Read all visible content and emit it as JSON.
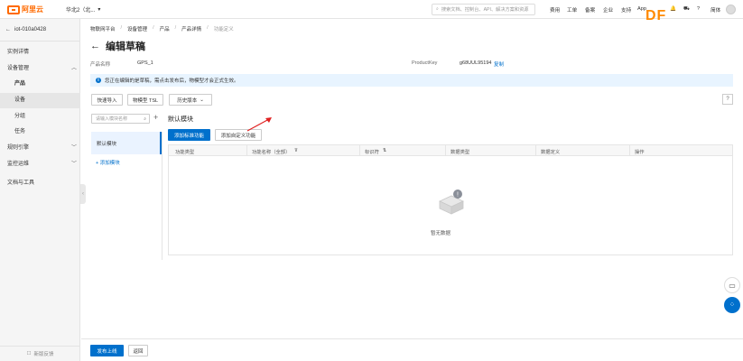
{
  "topbar": {
    "brand": "阿里云",
    "workspace": "华北2（北...",
    "search_placeholder": "搜索文档、控制台、API、解决方案和资源",
    "nav": [
      "费用",
      "工单",
      "备案",
      "企业",
      "支持",
      "App"
    ],
    "lang": "简体",
    "watermark": "DF"
  },
  "sidebar": {
    "instance": "iot-010a0428",
    "items": {
      "instance_detail": "实例详情",
      "device_management": "设备管理",
      "product": "产品",
      "device": "设备",
      "group": "分组",
      "task": "任务",
      "rule_engine": "规则引擎",
      "monitor": "监控运维",
      "docs_tools": "文档与工具"
    },
    "bottom": "新版反馈"
  },
  "breadcrumb": [
    "物联网平台",
    "设备管理",
    "产品",
    "产品详情",
    "功能定义"
  ],
  "page": {
    "title": "编辑草稿",
    "product_name_label": "产品名称",
    "product_name_value": "GPS_1",
    "product_key_label": "ProductKey",
    "product_key_value": "g68UUL95194",
    "copy_label": "复制"
  },
  "notice": "您正在编辑的是草稿，需点击发布后，物模型才会正式生效。",
  "toolbar": {
    "quick_import": "快速导入",
    "tsl": "物模型 TSL",
    "history": "历史版本"
  },
  "modules": {
    "search_placeholder": "请输入模块名称",
    "default": "默认模块",
    "add": "+ 添加模块",
    "current_title": "默认模块"
  },
  "actions": {
    "add_standard": "添加标准功能",
    "add_custom": "添加自定义功能"
  },
  "table": {
    "headers": [
      "功能类型",
      "功能名称（全部）",
      "标识符",
      "数据类型",
      "数据定义",
      "操作"
    ],
    "empty": "暂无数据"
  },
  "footer": {
    "publish": "发布上线",
    "back": "返回"
  },
  "colors": {
    "brand_orange": "#ff6a00",
    "primary_blue": "#0070cc",
    "notice_bg": "#e8f4ff",
    "annotation_red": "#e02020"
  }
}
